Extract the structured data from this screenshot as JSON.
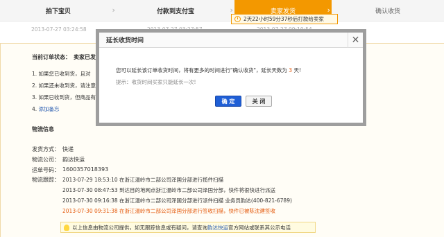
{
  "steps": [
    {
      "label": "拍下宝贝",
      "time": "2013-07-27 03:24:58"
    },
    {
      "label": "付款到支付宝",
      "time": "2013-07-27 03:27:57"
    },
    {
      "label": "卖家发货",
      "time": "2013-07-27 09:19:54"
    },
    {
      "label": "确认收货",
      "time": ""
    }
  ],
  "countdown": "2天22小时59分37秒后打款给卖家",
  "order": {
    "status_label": "当前订单状态：",
    "status_value": "卖家已发",
    "items": [
      "1. 如果您已收到货，且对",
      "2. 如果还未收到货，请注意",
      "3. 如果已收到货，但商品有",
      "4."
    ],
    "add_note_link": "添加备忘"
  },
  "logistics": {
    "title": "物流信息",
    "ship_label": "发货方式：",
    "ship_value": "快递",
    "company_label": "物流公司：",
    "company_value": "韵达快运",
    "tracking_label": "运单号码：",
    "tracking_value": "1600357018393",
    "track_label": "物流跟踪：",
    "events": [
      "2013-07-29 18:53:10 在浙江温岭市二部公司泽国分部进行揽件扫描",
      "2013-07-30 08:47:53 到达目的地网点浙江温岭市二部公司泽国分部，快件将很快进行派送",
      "2013-07-30 09:16:38 在浙江温岭市二部公司泽国分部进行派件扫描 业务员韵达(400-821-6789)",
      "2013-07-30 09:31:38 在浙江温岭市二部公司泽国分部进行签收扫描，快件已被陈沈建签收"
    ],
    "tip_text": "以上信息由物流公司提供，如无跟踪信息或有疑问，请查询",
    "tip_link": "韵达快运",
    "tip_suffix": "官方网站或联系其公示电话"
  },
  "dialog": {
    "title": "延长收货时间",
    "message_prefix": "您可以延长该订单收货时间，将有更多的时间进行\"确认收货\"，延长天数为 ",
    "days": "3",
    "message_suffix": " 天!",
    "hint": "提示：收货时间买家只能延长一次!",
    "ok": "确 定",
    "cancel": "关 闭",
    "close": "✕"
  },
  "colors": {
    "accent": "#f39800",
    "primary_button": "#1f5fd6",
    "highlight": "#e4580a"
  }
}
